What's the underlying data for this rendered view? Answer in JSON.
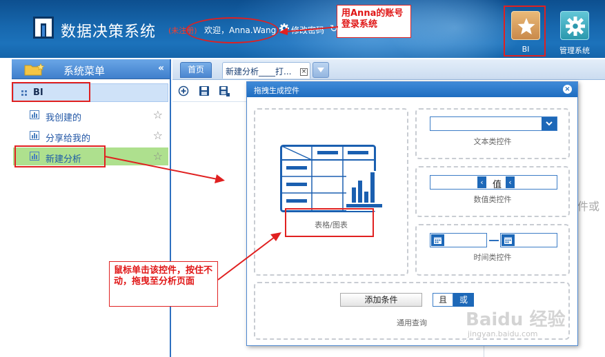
{
  "header": {
    "app_title": "数据决策系统",
    "unregistered": "(未注册)",
    "welcome": "欢迎，Anna.Wang",
    "change_password": "修改密码",
    "nav": [
      {
        "label": "BI",
        "icon": "star-icon"
      },
      {
        "label": "管理系统",
        "icon": "gear-icon"
      }
    ]
  },
  "sidebar": {
    "title": "系统菜单",
    "collapse_icon": "double-chevron-left-icon",
    "root": {
      "label": "BI",
      "icon": "grid-icon"
    },
    "items": [
      {
        "label": "我创建的",
        "icon": "bar-chart-icon",
        "fav_icon": "star-outline-icon"
      },
      {
        "label": "分享给我的",
        "icon": "bar-chart-icon",
        "fav_icon": "star-outline-icon"
      },
      {
        "label": "新建分析",
        "icon": "bar-chart-icon",
        "fav_icon": "star-outline-icon",
        "active": true
      }
    ]
  },
  "tabs": {
    "home": "首页",
    "analysis": "新建分析____打...",
    "close_glyph": "⊠"
  },
  "dialog": {
    "title": "拖拽生成控件",
    "close_glyph": "×",
    "table_chart_label": "表格/图表",
    "text_control_label": "文本类控件",
    "number_control_label": "数值类控件",
    "number_value": "值",
    "time_control_label": "时间类控件",
    "add_condition": "添加条件",
    "and_label": "且",
    "or_label": "或",
    "general_query_label": "通用查询"
  },
  "background": {
    "partial_text": "件或"
  },
  "annotations": {
    "login_note": "用Anna的账号登录系统",
    "drag_note": "鼠标单击该控件，按住不动，拖曳至分析页面"
  },
  "watermark": {
    "main": "Baidu 经验",
    "sub": "jingyan.baidu.com"
  },
  "colors": {
    "header_blue": "#1767ad",
    "accent_blue": "#1d68b8",
    "active_green": "#aee08e",
    "annotation_red": "#e02020",
    "bi_tile": "#d9a262",
    "admin_tile": "#2b98ad"
  }
}
